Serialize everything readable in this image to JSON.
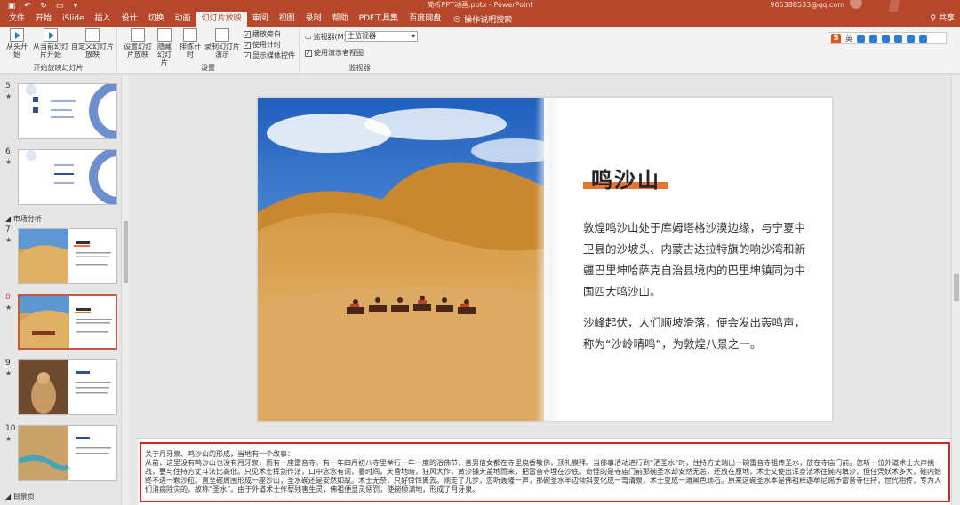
{
  "titlebar": {
    "doc_title": "简析PPT动画.pptx  -  PowerPoint",
    "account": "905388533@qq.com",
    "accent": "#b7472a"
  },
  "tabs": [
    "文件",
    "开始",
    "iSlide",
    "插入",
    "设计",
    "切换",
    "动画",
    "幻灯片放映",
    "审阅",
    "视图",
    "录制",
    "帮助",
    "PDF工具集",
    "百度网盘"
  ],
  "active_tab": "幻灯片放映",
  "tell_me": "操作说明搜索",
  "share": "共享",
  "ribbon": {
    "groups": {
      "start": {
        "label": "开始放映幻灯片",
        "from_start": "从头开始",
        "from_current": "从当前幻灯片开始",
        "custom": "自定义幻灯片放映"
      },
      "setup": {
        "label": "设置",
        "setup_show": "设置幻灯片放映",
        "hide": "隐藏幻灯片",
        "rehearse": "排练计时",
        "record": "录制幻灯片演示",
        "chk_narration": "播放旁白",
        "chk_timing": "使用计时",
        "chk_media": "显示媒体控件"
      },
      "monitor": {
        "label": "监视器",
        "monitor_label": "监视器(M):",
        "monitor_value": "主监视器",
        "presenter_view": "使用演示者视图"
      }
    },
    "ime": {
      "s": "S",
      "text": "英"
    }
  },
  "slides_panel": {
    "section_market": "市场分析",
    "section_end": "目景页",
    "thumbs": [
      {
        "num": "5",
        "star": "★"
      },
      {
        "num": "6",
        "star": "★"
      },
      {
        "num": "7",
        "star": "★"
      },
      {
        "num": "8",
        "star": "★"
      },
      {
        "num": "9",
        "star": "★"
      },
      {
        "num": "10",
        "star": "★"
      }
    ]
  },
  "slide": {
    "title": "鸣沙山",
    "para1": "敦煌鸣沙山处于库姆塔格沙漠边缘，与宁夏中卫县的沙坡头、内蒙古达拉特旗的响沙湾和新疆巴里坤哈萨克自治县境内的巴里坤镇同为中国四大鸣沙山。",
    "para2": "沙峰起伏，人们顺坡滑落，便会发出轰鸣声，称为“沙岭晴鸣”，为敦煌八景之一。"
  },
  "notes": {
    "line1": "关于月牙泉、鸣沙山的形成，当地有一个故事：",
    "line2": "从前，这里没有鸣沙山也没有月牙泉，而有一座雷音寺。有一年四月初八寺里举行一年一度的浴佛节，善男信女都在寺里烧香敬佛，顶礼膜拜。当佛事活动进行到“洒圣水”时，住持方丈端出一碗雷音寺祖传圣水，放在寺庙门前。忽听一位外道术士大声挑战，要与住持方丈斗法比高低。只见术士挥剑作法，口中念念有词，霎时间，天昏地暗，狂风大作，黄沙铺天盖地而来，把雷音寺埋在沙底。奇怪的是寺庙门前那碗圣水却安然无恙，还放在原地，术士又使出浑身法术往碗内填沙，但任凭妖术多大，碗内始终不进一颗沙粒。直至碗周围形成一座沙山，圣水碗还是安然如故。术士无奈，只好悻悻离去。刚走了几步，忽听轰隆一声，那碗圣水半边倾斜变化成一弯清泉，术士变成一滩黑色顽石。原来这碗圣水本是佛祖释迦牟尼赐予雷音寺住持，世代相传，专为人们消病除灾的，故称“圣水”。由于外道术士作孽残害生灵，佛祖便显灵惩罚，使碗倾满地，形成了月牙泉。"
  }
}
